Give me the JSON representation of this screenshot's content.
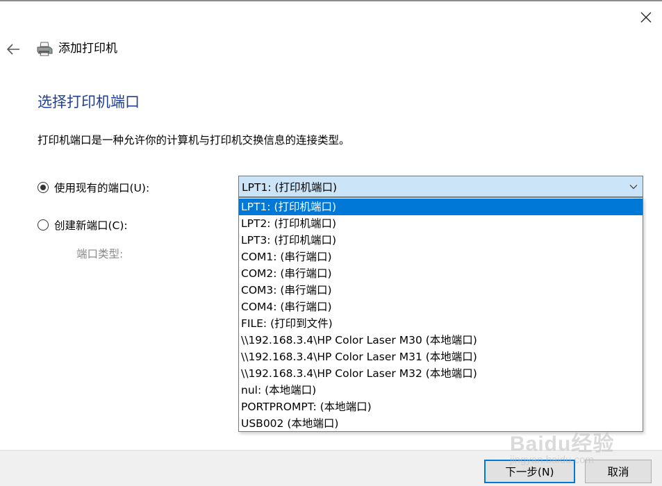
{
  "window": {
    "title": "添加打印机"
  },
  "page": {
    "heading": "选择打印机端口",
    "description": "打印机端口是一种允许你的计算机与打印机交换信息的连接类型。"
  },
  "options": {
    "use_existing_label": "使用现有的端口(U):",
    "use_existing_selected": true,
    "create_new_label": "创建新端口(C):",
    "create_new_selected": false,
    "port_type_label": "端口类型:"
  },
  "port_combo": {
    "selected_value": "LPT1: (打印机端口)",
    "items": [
      "LPT1: (打印机端口)",
      "LPT2: (打印机端口)",
      "LPT3: (打印机端口)",
      "COM1: (串行端口)",
      "COM2: (串行端口)",
      "COM3: (串行端口)",
      "COM4: (串行端口)",
      "FILE: (打印到文件)",
      "\\\\192.168.3.4\\HP Color Laser M30 (本地端口)",
      "\\\\192.168.3.4\\HP Color Laser M31 (本地端口)",
      "\\\\192.168.3.4\\HP Color Laser M32 (本地端口)",
      "nul: (本地端口)",
      "PORTPROMPT: (本地端口)",
      "USB002 (本地端口)"
    ],
    "highlighted_index": 0
  },
  "footer": {
    "next_label": "下一步(N)",
    "cancel_label": "取消"
  },
  "watermark": {
    "text": "Baidu经验",
    "sub": "jingyan.baidu.com"
  },
  "colors": {
    "heading": "#1e3f96",
    "selection": "#0078d7",
    "combo_background": "#cce4f7",
    "footer_background": "#f0f0f0"
  },
  "icons": {
    "close": "close-icon",
    "back": "back-arrow-icon",
    "printer": "printer-icon",
    "dropdown": "chevron-down-icon"
  }
}
